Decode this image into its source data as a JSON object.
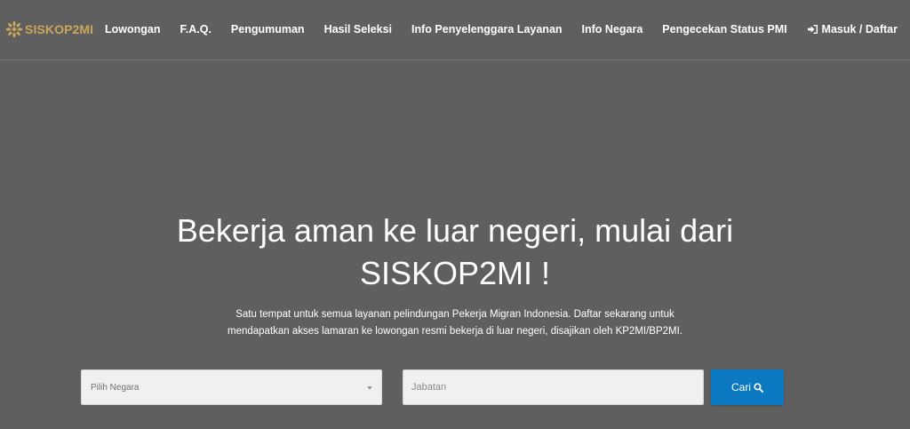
{
  "brand": {
    "name": "SISKOP2MI",
    "logo_icon": "sunburst-logo-icon",
    "color": "#c9a65c"
  },
  "nav": {
    "items": [
      {
        "label": "Lowongan"
      },
      {
        "label": "F.A.Q."
      },
      {
        "label": "Pengumuman"
      },
      {
        "label": "Hasil Seleksi"
      },
      {
        "label": "Info Penyelenggara Layanan"
      },
      {
        "label": "Info Negara"
      },
      {
        "label": "Pengecekan Status PMI"
      }
    ],
    "login": {
      "label": "Masuk / Daftar",
      "icon": "sign-in-icon"
    }
  },
  "hero": {
    "title_line1": "Bekerja aman ke luar negeri, mulai dari",
    "title_line2": "SISKOP2MI !",
    "desc_line1": "Satu tempat untuk semua layanan pelindungan Pekerja Migran Indonesia. Daftar sekarang untuk",
    "desc_line2": "mendapatkan akses lamaran ke lowongan resmi bekerja di luar negeri, disajikan oleh KP2MI/BP2MI."
  },
  "search": {
    "country_select": {
      "selected": "Pilih Negara"
    },
    "position_input": {
      "placeholder": "Jabatan",
      "value": ""
    },
    "button": {
      "label": "Cari",
      "icon": "search-icon",
      "color": "#0b78c2"
    }
  },
  "colors": {
    "background": "#5f5f5f",
    "text": "#ffffff"
  }
}
